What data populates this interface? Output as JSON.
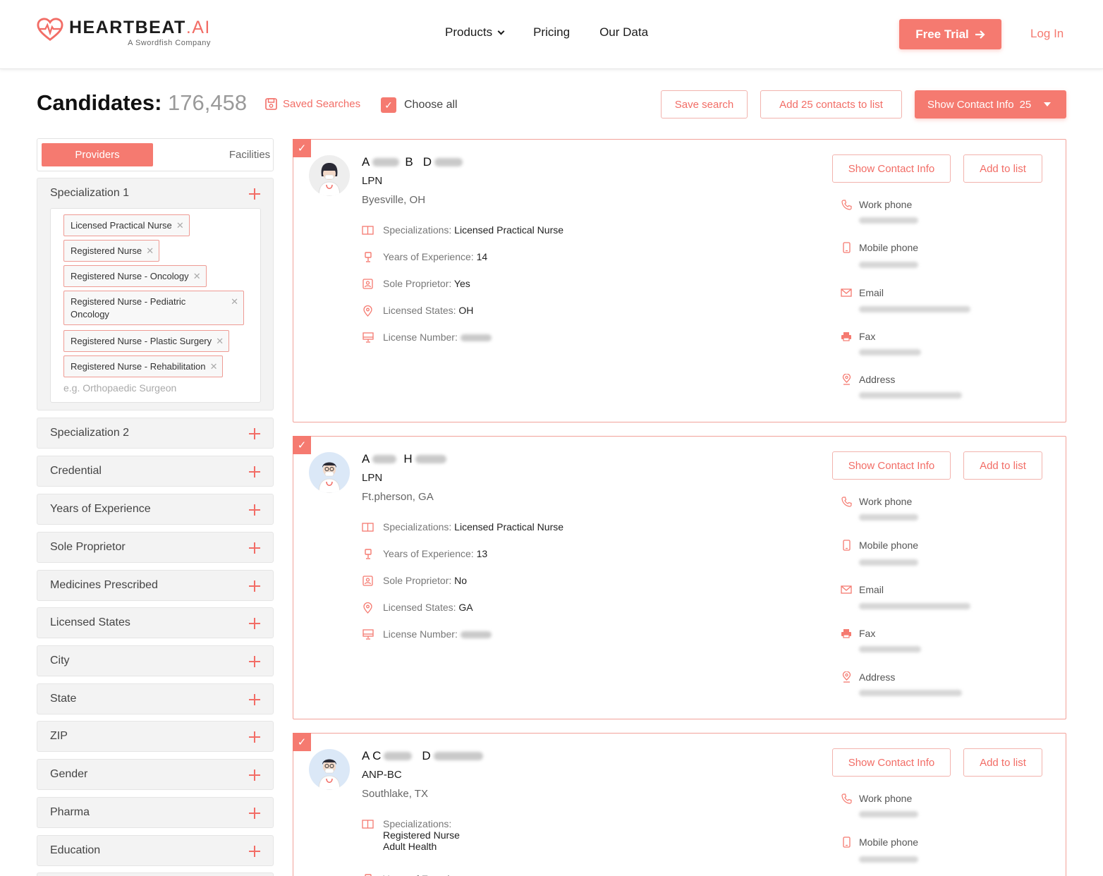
{
  "brand": {
    "name": "HEARTBEAT",
    "name_suffix": ".AI",
    "tagline": "A Swordfish Company"
  },
  "nav": {
    "products": "Products",
    "pricing": "Pricing",
    "our_data": "Our Data",
    "free_trial": "Free Trial",
    "login": "Log In"
  },
  "toolbar": {
    "title": "Candidates:",
    "count": "176,458",
    "saved_searches": "Saved Searches",
    "choose_all": "Choose all",
    "save_search": "Save search",
    "add_contacts": "Add 25 contacts to list",
    "show_contact_info": "Show Contact Info",
    "show_contact_count": "25"
  },
  "sidebar": {
    "tabs": {
      "providers": "Providers",
      "facilities": "Facilities"
    },
    "spec1": {
      "label": "Specialization 1",
      "tags": [
        "Licensed Practical Nurse",
        "Registered Nurse",
        "Registered Nurse - Oncology",
        "Registered Nurse - Pediatric Oncology",
        "Registered Nurse - Plastic Surgery",
        "Registered Nurse - Rehabilitation"
      ],
      "placeholder": "e.g. Orthopaedic Surgeon"
    },
    "facets": [
      "Specialization 2",
      "Credential",
      "Years of Experience",
      "Sole Proprietor",
      "Medicines Prescribed",
      "Licensed States",
      "City",
      "State",
      "ZIP",
      "Gender",
      "Pharma",
      "Education"
    ]
  },
  "card_labels": {
    "show_contact": "Show Contact Info",
    "add_to_list": "Add to list",
    "specializations": "Specializations:",
    "years": "Years of Experience:",
    "sole": "Sole Proprietor:",
    "states": "Licensed States:",
    "license": "License Number:",
    "work_phone": "Work phone",
    "mobile_phone": "Mobile phone",
    "email": "Email",
    "fax": "Fax",
    "address": "Address"
  },
  "candidates": [
    {
      "initials": [
        "A",
        "B",
        "D"
      ],
      "credential": "LPN",
      "location": "Byesville, OH",
      "specialization": "Licensed Practical Nurse",
      "years": "14",
      "sole": "Yes",
      "states": "OH"
    },
    {
      "initials": [
        "A",
        "H"
      ],
      "credential": "LPN",
      "location": "Ft.pherson, GA",
      "specialization": "Licensed Practical Nurse",
      "years": "13",
      "sole": "No",
      "states": "GA"
    },
    {
      "initials": [
        "A C",
        "D"
      ],
      "credential": "ANP-BC",
      "location": "Southlake, TX",
      "specialization_line1": "Registered Nurse",
      "specialization_line2": "Adult Health"
    }
  ],
  "colors": {
    "accent": "#f57a70",
    "accent_text": "#f26d66",
    "border_accent": "#f2a29a"
  },
  "icons": {
    "logo": "heart-pulse-icon",
    "arrow": "arrow-right-icon",
    "save": "floppy-disk-icon",
    "check": "check-icon",
    "plus": "plus-icon",
    "remove": "close-icon",
    "spec": "book-icon",
    "years": "trophy-icon",
    "sole": "id-card-icon",
    "states": "map-pin-icon",
    "license": "monitor-icon",
    "phone": "phone-icon",
    "mobile": "mobile-icon",
    "email": "envelope-icon",
    "fax": "printer-icon",
    "address": "location-icon"
  }
}
